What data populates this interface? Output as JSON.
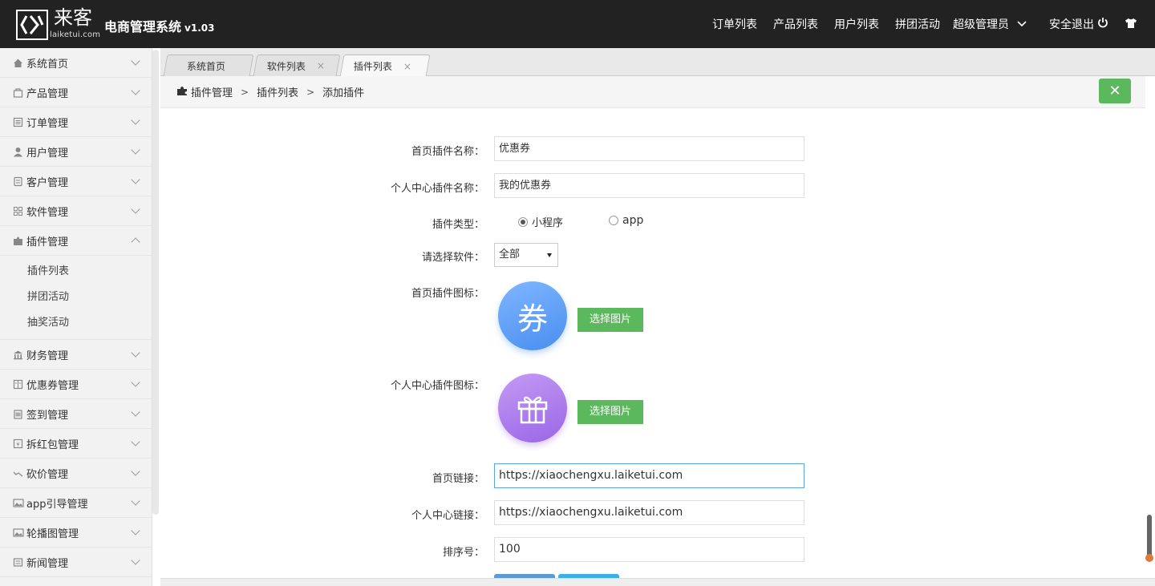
{
  "header": {
    "logo_cn": "来客",
    "logo_en": "laiketui.com",
    "title": "电商管理系统",
    "version": "v1.03",
    "nav": [
      "订单列表",
      "产品列表",
      "用户列表",
      "拼团活动"
    ],
    "admin_label": "超级管理员",
    "logout_label": "安全退出"
  },
  "sidebar": {
    "items": [
      {
        "label": "系统首页",
        "icon": "home-icon"
      },
      {
        "label": "产品管理",
        "icon": "bag-icon"
      },
      {
        "label": "订单管理",
        "icon": "list-icon"
      },
      {
        "label": "用户管理",
        "icon": "user-icon"
      },
      {
        "label": "客户管理",
        "icon": "doc-icon"
      },
      {
        "label": "软件管理",
        "icon": "grid-icon"
      },
      {
        "label": "插件管理",
        "icon": "puzzle-icon"
      },
      {
        "label": "财务管理",
        "icon": "bank-icon"
      },
      {
        "label": "优惠券管理",
        "icon": "ticket-icon"
      },
      {
        "label": "签到管理",
        "icon": "calendar-icon"
      },
      {
        "label": "拆红包管理",
        "icon": "redpacket-icon"
      },
      {
        "label": "砍价管理",
        "icon": "trend-icon"
      },
      {
        "label": "app引导管理",
        "icon": "image-icon"
      },
      {
        "label": "轮播图管理",
        "icon": "image-icon"
      },
      {
        "label": "新闻管理",
        "icon": "news-icon"
      }
    ],
    "sub_items": [
      "插件列表",
      "拼团活动",
      "抽奖活动"
    ]
  },
  "tabs": [
    {
      "label": "系统首页"
    },
    {
      "label": "软件列表",
      "close": "×"
    },
    {
      "label": "插件列表",
      "close": "×"
    }
  ],
  "breadcrumb": {
    "items": [
      "插件管理",
      "插件列表",
      "添加插件"
    ],
    "sep": ">"
  },
  "close_button": "✕",
  "form": {
    "home_name_label": "首页插件名称：",
    "home_name_value": "优惠券",
    "center_name_label": "个人中心插件名称：",
    "center_name_value": "我的优惠券",
    "type_label": "插件类型：",
    "type_options": [
      "小程序",
      "app"
    ],
    "type_selected": "小程序",
    "software_label": "请选择软件：",
    "software_value": "全部",
    "home_icon_label": "首页插件图标：",
    "home_icon_glyph": "券",
    "center_icon_label": "个人中心插件图标：",
    "choose_image": "选择图片",
    "home_link_label": "首页链接：",
    "home_link_value": "https://xiaochengxu.laiketui.com",
    "center_link_label": "个人中心链接：",
    "center_link_value": "https://xiaochengxu.laiketui.com",
    "sort_label": "排序号：",
    "sort_value": "100"
  },
  "colors": {
    "header_bg": "#222222",
    "accent_green": "#5cb85c",
    "coupon_blue": "#4a8ef0",
    "gift_purple": "#9a66e6"
  }
}
